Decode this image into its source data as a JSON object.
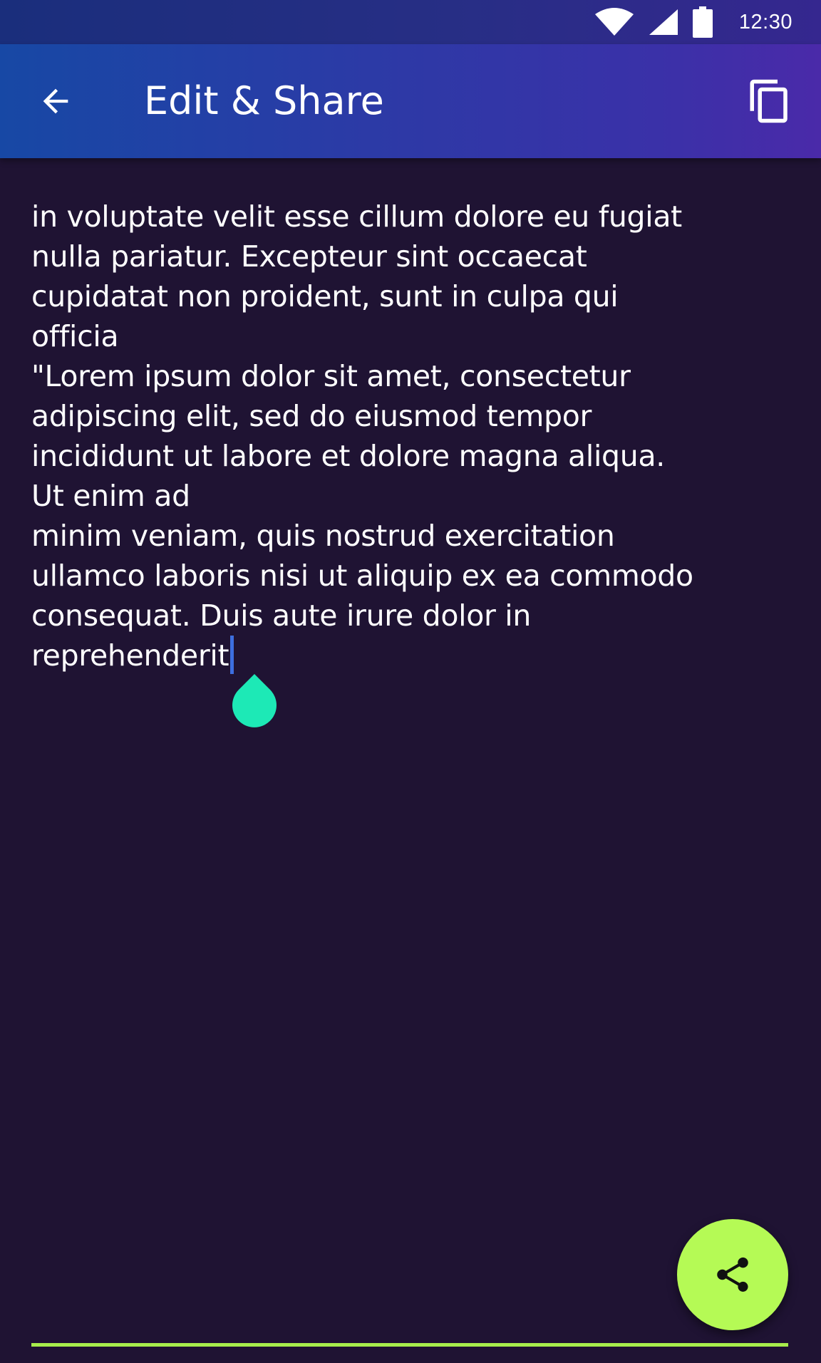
{
  "status_bar": {
    "time": "12:30",
    "icons": [
      "wifi-icon",
      "cell-signal-icon",
      "battery-icon"
    ]
  },
  "app_bar": {
    "back_icon": "arrow-back-icon",
    "title": "Edit & Share",
    "copy_icon": "content-copy-icon"
  },
  "editor": {
    "text": "in voluptate velit esse cillum dolore eu fugiat\nnulla pariatur. Excepteur sint occaecat\ncupidatat non proident, sunt in culpa qui\nofficia\n\"Lorem ipsum dolor sit amet, consectetur\nadipiscing elit, sed do eiusmod tempor\nincididunt ut labore et dolore magna aliqua.\nUt enim ad\nminim veniam, quis nostrud exercitation\nullamco laboris nisi ut aliquip ex ea commodo\nconsequat. Duis aute irure dolor in\nreprehenderit"
  },
  "fab": {
    "icon": "share-icon"
  },
  "colors": {
    "background": "#1f1333",
    "app_bar_start": "#1748a5",
    "app_bar_end": "#4a2aa9",
    "accent_lime": "#b5fa55",
    "cursor_handle": "#1de9b6",
    "caret": "#3d6fe0"
  }
}
